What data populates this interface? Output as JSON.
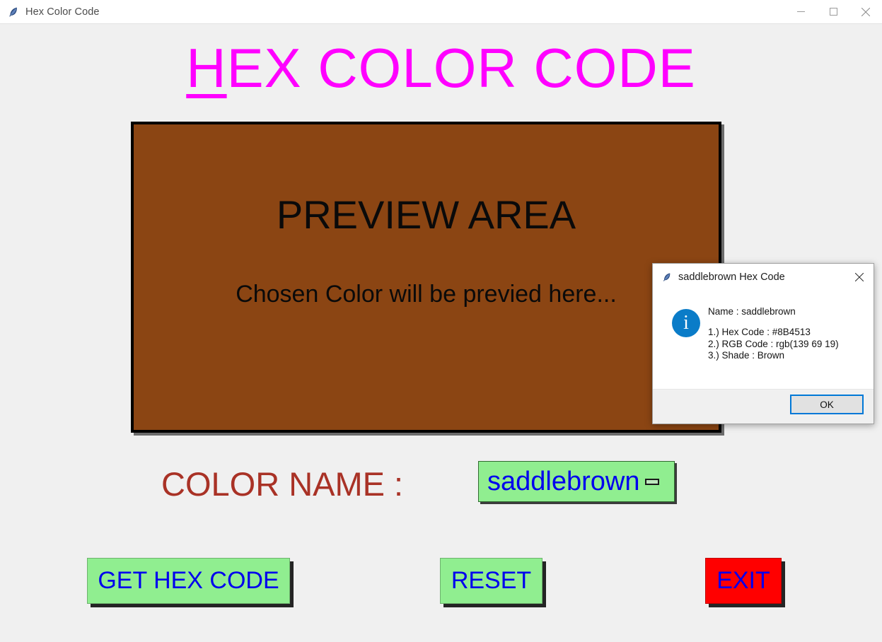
{
  "window": {
    "title": "Hex Color Code",
    "icon": "feather-icon",
    "controls": {
      "minimize": "minimize-icon",
      "maximize": "maximize-icon",
      "close": "close-icon"
    }
  },
  "heading": {
    "underlined_letter": "H",
    "rest": "EX COLOR CODE"
  },
  "preview": {
    "title": "PREVIEW AREA",
    "subtitle": "Chosen Color will be previed here...",
    "background_color": "#8B4513",
    "border_color": "#000000"
  },
  "color_row": {
    "label": "COLOR NAME :",
    "label_color": "#a93226",
    "dropdown": {
      "selected": "saddlebrown",
      "background_color": "#90EE90",
      "text_color": "#0000EE",
      "indicator": "dropdown-dash-indicator"
    }
  },
  "buttons": [
    {
      "id": "get-hex-code",
      "label": "GET HEX CODE",
      "background_color": "#90EE90",
      "text_color": "#0000EE"
    },
    {
      "id": "reset",
      "label": "RESET",
      "background_color": "#90EE90",
      "text_color": "#0000EE"
    },
    {
      "id": "exit",
      "label": "EXIT",
      "background_color": "#FF0000",
      "text_color": "#0000EE"
    }
  ],
  "dialog": {
    "title": "saddlebrown Hex Code",
    "icon": "feather-icon",
    "close_icon": "close-icon",
    "info_icon": "info-icon",
    "info_icon_color": "#0A7CC8",
    "name_line": "Name :  saddlebrown",
    "details": [
      "1.)  Hex Code  :  #8B4513",
      "2.)  RGB Code  :  rgb(139 69 19)",
      "3.)  Shade  :  Brown"
    ],
    "ok_label": "OK",
    "ok_focus_color": "#0078D7"
  }
}
